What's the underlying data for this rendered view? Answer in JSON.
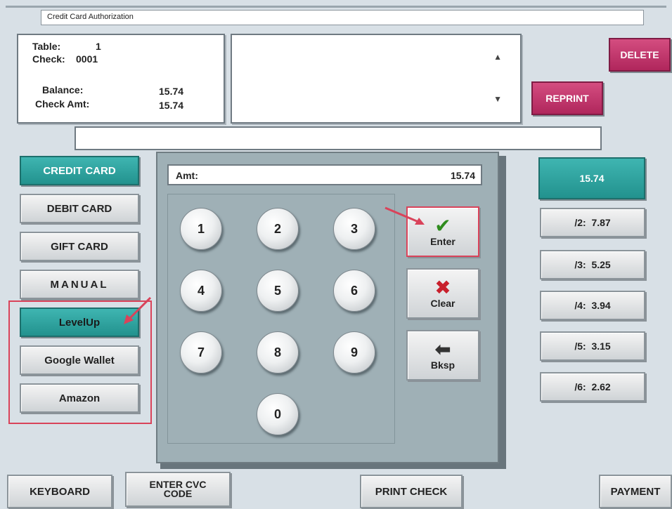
{
  "window": {
    "title": "Credit Card Authorization"
  },
  "check_info": {
    "table_label": "Table:",
    "table_value": "1",
    "check_label": "Check:",
    "check_value": "0001",
    "balance_label": "Balance:",
    "balance_value": "15.74",
    "check_amt_label": "Check Amt:",
    "check_amt_value": "15.74"
  },
  "top_buttons": {
    "delete": "DELETE",
    "reprint": "REPRINT"
  },
  "payment_types": [
    "CREDIT CARD",
    "DEBIT CARD",
    "GIFT CARD",
    "MANUAL",
    "LevelUp",
    "Google Wallet",
    "Amazon"
  ],
  "amount": {
    "label": "Amt:",
    "value": "15.74"
  },
  "keypad": [
    "1",
    "2",
    "3",
    "4",
    "5",
    "6",
    "7",
    "8",
    "9",
    "0"
  ],
  "actions": {
    "enter": "Enter",
    "clear": "Clear",
    "bksp": "Bksp"
  },
  "split": {
    "total": "15.74",
    "rows": [
      {
        "label": "/2:",
        "value": "7.87"
      },
      {
        "label": "/3:",
        "value": "5.25"
      },
      {
        "label": "/4:",
        "value": "3.94"
      },
      {
        "label": "/5:",
        "value": "3.15"
      },
      {
        "label": "/6:",
        "value": "2.62"
      }
    ]
  },
  "bottom": {
    "keyboard": "KEYBOARD",
    "cvc_line1": "ENTER CVC",
    "cvc_line2": "CODE",
    "print_check": "PRINT CHECK",
    "payment": "PAYMENT"
  },
  "colors": {
    "teal": "#2aa6a2",
    "pink": "#c03a6c",
    "annotation_red": "#d9435a"
  }
}
